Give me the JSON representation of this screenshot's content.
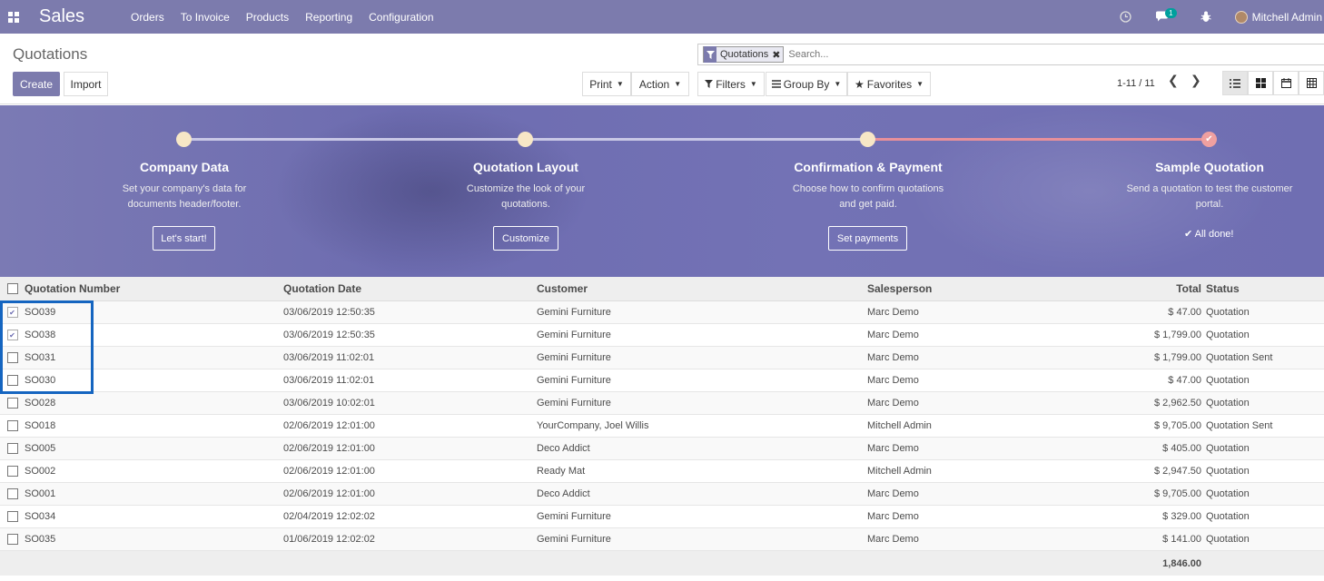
{
  "navbar": {
    "app_name": "Sales",
    "menu": [
      "Orders",
      "To Invoice",
      "Products",
      "Reporting",
      "Configuration"
    ],
    "messages_count": "1",
    "user_name": "Mitchell Admin"
  },
  "control_panel": {
    "title": "Quotations",
    "create_label": "Create",
    "import_label": "Import",
    "print_label": "Print",
    "action_label": "Action",
    "facet_label": "Quotations",
    "search_placeholder": "Search...",
    "filters_label": "Filters",
    "groupby_label": "Group By",
    "favorites_label": "Favorites",
    "pager": "1-11 / 11"
  },
  "onboarding": {
    "steps": [
      {
        "title": "Company Data",
        "desc": "Set your company's data for documents header/footer.",
        "button": "Let's start!"
      },
      {
        "title": "Quotation Layout",
        "desc": "Customize the look of your quotations.",
        "button": "Customize"
      },
      {
        "title": "Confirmation & Payment",
        "desc": "Choose how to confirm quotations and get paid.",
        "button": "Set payments"
      },
      {
        "title": "Sample Quotation",
        "desc": "Send a quotation to test the customer portal.",
        "done": "All done!"
      }
    ]
  },
  "table": {
    "headers": {
      "number": "Quotation Number",
      "date": "Quotation Date",
      "customer": "Customer",
      "salesperson": "Salesperson",
      "total": "Total",
      "status": "Status"
    },
    "rows": [
      {
        "checked": true,
        "number": "SO039",
        "date": "03/06/2019 12:50:35",
        "customer": "Gemini Furniture",
        "salesperson": "Marc Demo",
        "total": "$ 47.00",
        "status": "Quotation"
      },
      {
        "checked": true,
        "number": "SO038",
        "date": "03/06/2019 12:50:35",
        "customer": "Gemini Furniture",
        "salesperson": "Marc Demo",
        "total": "$ 1,799.00",
        "status": "Quotation"
      },
      {
        "checked": false,
        "number": "SO031",
        "date": "03/06/2019 11:02:01",
        "customer": "Gemini Furniture",
        "salesperson": "Marc Demo",
        "total": "$ 1,799.00",
        "status": "Quotation Sent"
      },
      {
        "checked": false,
        "number": "SO030",
        "date": "03/06/2019 11:02:01",
        "customer": "Gemini Furniture",
        "salesperson": "Marc Demo",
        "total": "$ 47.00",
        "status": "Quotation"
      },
      {
        "checked": false,
        "number": "SO028",
        "date": "03/06/2019 10:02:01",
        "customer": "Gemini Furniture",
        "salesperson": "Marc Demo",
        "total": "$ 2,962.50",
        "status": "Quotation"
      },
      {
        "checked": false,
        "number": "SO018",
        "date": "02/06/2019 12:01:00",
        "customer": "YourCompany, Joel Willis",
        "salesperson": "Mitchell Admin",
        "total": "$ 9,705.00",
        "status": "Quotation Sent"
      },
      {
        "checked": false,
        "number": "SO005",
        "date": "02/06/2019 12:01:00",
        "customer": "Deco Addict",
        "salesperson": "Marc Demo",
        "total": "$ 405.00",
        "status": "Quotation"
      },
      {
        "checked": false,
        "number": "SO002",
        "date": "02/06/2019 12:01:00",
        "customer": "Ready Mat",
        "salesperson": "Mitchell Admin",
        "total": "$ 2,947.50",
        "status": "Quotation"
      },
      {
        "checked": false,
        "number": "SO001",
        "date": "02/06/2019 12:01:00",
        "customer": "Deco Addict",
        "salesperson": "Marc Demo",
        "total": "$ 9,705.00",
        "status": "Quotation"
      },
      {
        "checked": false,
        "number": "SO034",
        "date": "02/04/2019 12:02:02",
        "customer": "Gemini Furniture",
        "salesperson": "Marc Demo",
        "total": "$ 329.00",
        "status": "Quotation"
      },
      {
        "checked": false,
        "number": "SO035",
        "date": "01/06/2019 12:02:02",
        "customer": "Gemini Furniture",
        "salesperson": "Marc Demo",
        "total": "$ 141.00",
        "status": "Quotation"
      }
    ],
    "footer_total": "1,846.00"
  },
  "colors": {
    "brand": "#7c7bad",
    "highlight": "#1565c0",
    "progress_done": "#f0a0a0"
  }
}
